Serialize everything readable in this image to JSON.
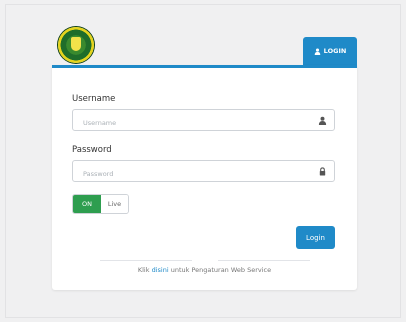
{
  "header": {
    "login_tab_label": "LOGIN",
    "login_tab_icon": "user-icon",
    "logo_icon": "institution-seal-logo"
  },
  "form": {
    "username_label": "Username",
    "username_placeholder": "Username",
    "username_value": "",
    "username_icon": "user-icon",
    "password_label": "Password",
    "password_placeholder": "Password",
    "password_value": "",
    "password_icon": "lock-icon",
    "mode_toggle": {
      "on_label": "ON",
      "off_label": "Live",
      "selected": "ON"
    },
    "submit_label": "Login"
  },
  "footer": {
    "prefix": "Klik ",
    "link_text": "disini",
    "suffix": " untuk Pengaturan Web Service"
  },
  "colors": {
    "accent": "#1f8ac8",
    "toggle_on": "#2e9e4f",
    "background": "#f0f0f1"
  }
}
